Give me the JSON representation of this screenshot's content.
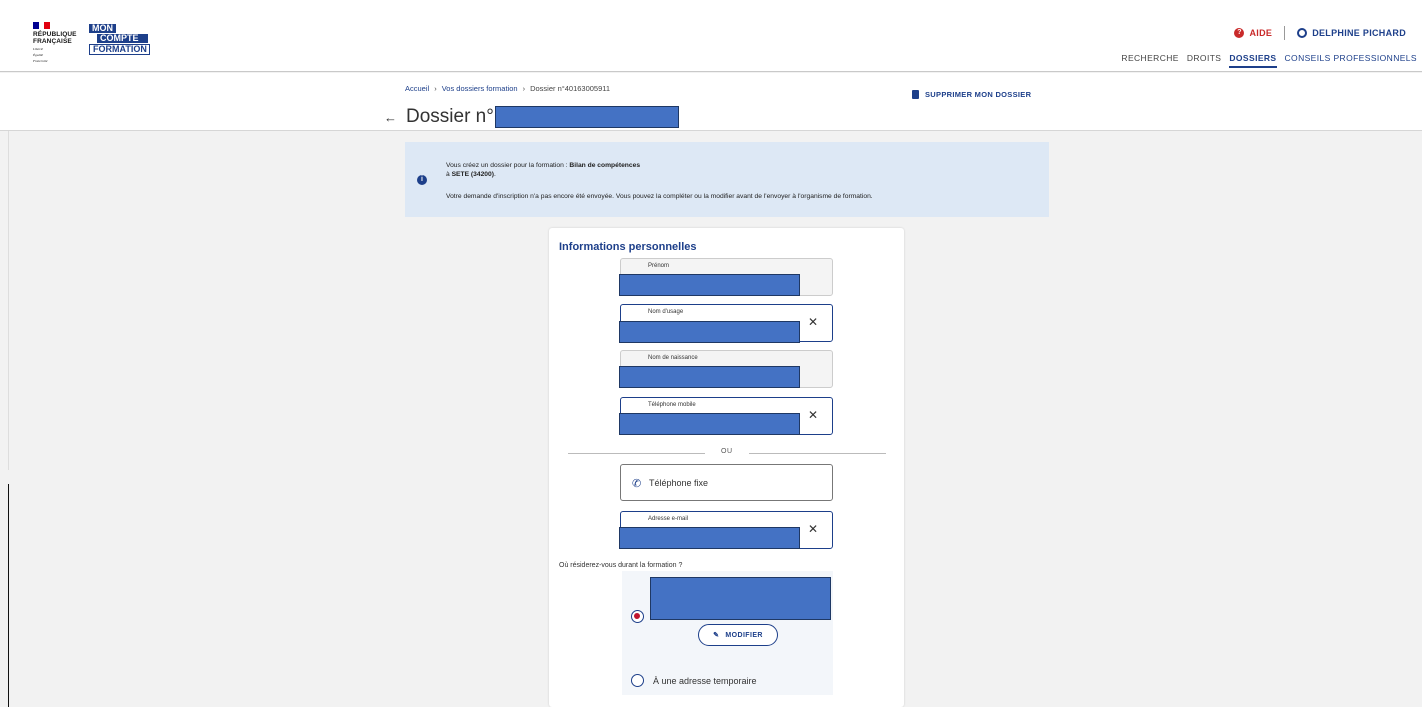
{
  "header": {
    "republique": [
      "RÉPUBLIQUE",
      "FRANÇAISE"
    ],
    "devise": [
      "Liberté",
      "Égalité",
      "Fraternité"
    ],
    "brand": [
      "MON",
      "COMPTE",
      "FORMATION"
    ],
    "aide": "AIDE",
    "user": "DELPHINE PICHARD",
    "nav": [
      "RECHERCHE",
      "DROITS",
      "DOSSIERS",
      "CONSEILS PROFESSIONNELS"
    ],
    "active_nav": "DOSSIERS"
  },
  "breadcrumb": {
    "home": "Accueil",
    "dossiers": "Vos dossiers formation",
    "current": "Dossier n°40163005911"
  },
  "delete_label": "SUPPRIMER MON DOSSIER",
  "page_title": "Dossier n°",
  "info": {
    "line1_prefix": "Vous créez un dossier pour la formation : ",
    "line1_strong": "Bilan de compétences",
    "line2_prefix": "à ",
    "line2_city": "SETE",
    "line2_postal": "(34200)",
    "line2_end": ".",
    "line3": "Votre demande d'inscription n'a pas encore été envoyée. Vous pouvez la compléter ou la modifier avant de l'envoyer à l'organisme de formation."
  },
  "form": {
    "title": "Informations personnelles",
    "fields": {
      "prenom": "Prénom",
      "nom_usage": "Nom d'usage",
      "nom_naissance": "Nom de naissance",
      "tel_mobile": "Téléphone mobile",
      "tel_fixe": "Téléphone fixe",
      "email": "Adresse e-mail"
    },
    "ou": "OU",
    "residence_question": "Où résiderez-vous durant la formation ?",
    "modifier": "MODIFIER",
    "temp_address": "À une adresse temporaire"
  },
  "colors": {
    "brand_blue": "#1d3f8a",
    "alert_red": "#c92a2a",
    "redaction_fill": "#4472c4",
    "info_bg": "#dde8f5"
  }
}
